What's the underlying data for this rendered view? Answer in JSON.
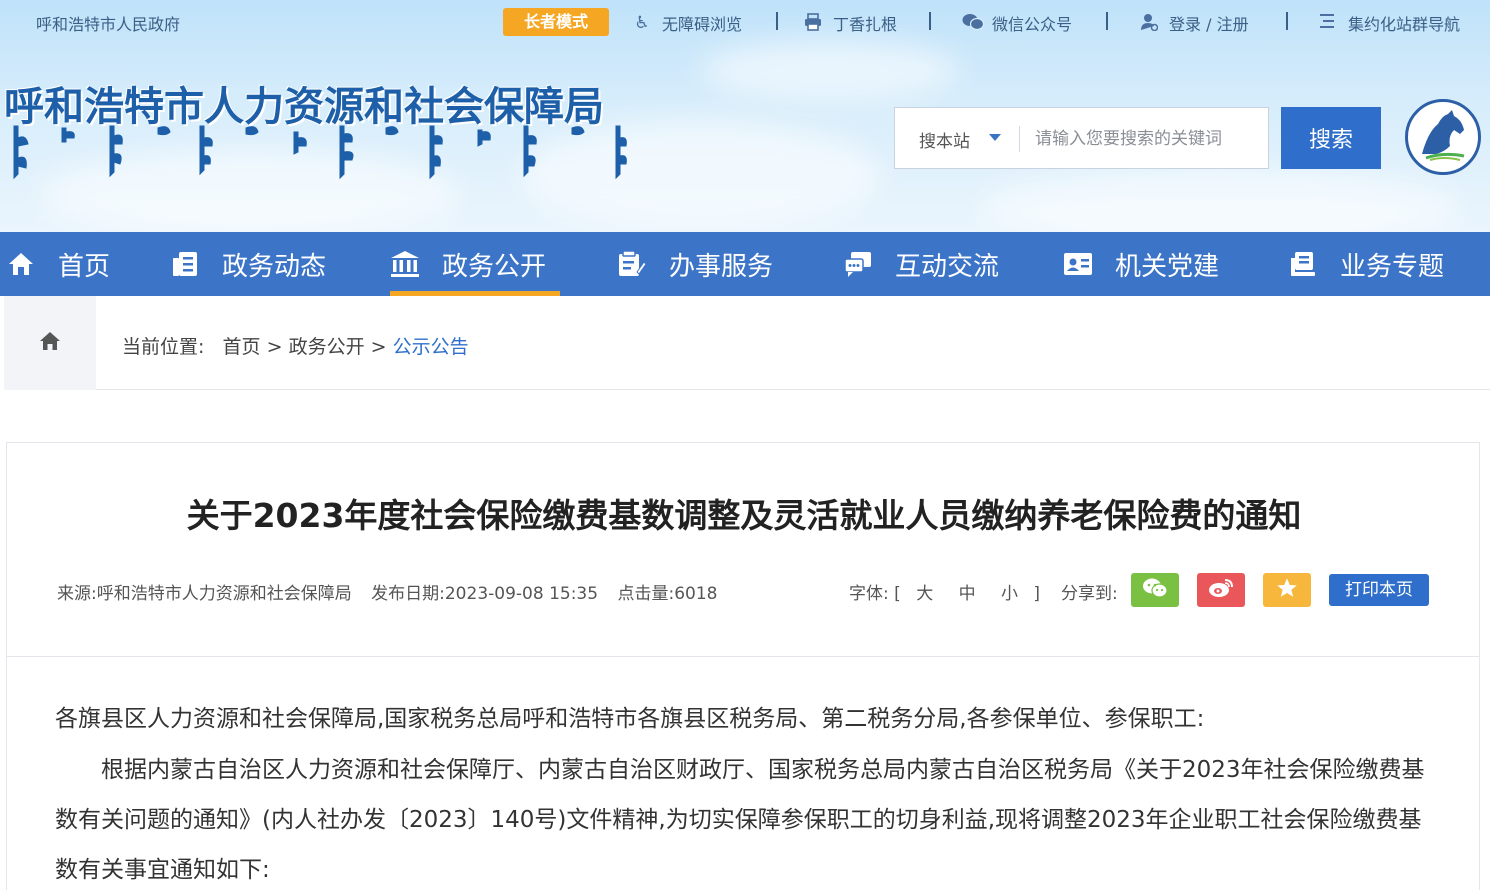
{
  "topbar": {
    "gov_link": "呼和浩特市人民政府",
    "elder_mode": "长者模式",
    "accessibility": "无障碍浏览",
    "dingxiang": "丁香扎根",
    "wechat": "微信公众号",
    "login": "登录 / 注册",
    "site_group": "集约化站群导航"
  },
  "header": {
    "site_title": "呼和浩特市人力资源和社会保障局"
  },
  "search": {
    "scope": "搜本站",
    "placeholder": "请输入您要搜索的关键词",
    "button": "搜索"
  },
  "nav": {
    "items": [
      {
        "label": "首页",
        "icon": "home-icon"
      },
      {
        "label": "政务动态",
        "icon": "news-icon"
      },
      {
        "label": "政务公开",
        "icon": "building-icon"
      },
      {
        "label": "办事服务",
        "icon": "service-icon"
      },
      {
        "label": "互动交流",
        "icon": "chat-icon"
      },
      {
        "label": "机关党建",
        "icon": "id-card-icon"
      },
      {
        "label": "业务专题",
        "icon": "topic-icon"
      }
    ],
    "active_index": 2
  },
  "breadcrumb": {
    "prefix": "当前位置:",
    "items": [
      "首页",
      "政务公开",
      "公示公告"
    ],
    "separator": ">"
  },
  "article": {
    "title": "关于2023年度社会保险缴费基数调整及灵活就业人员缴纳养老保险费的通知",
    "source": "来源:呼和浩特市人力资源和社会保障局",
    "date": "发布日期:2023-09-08 15:35",
    "clicks": "点击量:6018",
    "font_label": "字体:",
    "font_open": "[",
    "font_close": "]",
    "font_sizes": [
      "大",
      "中",
      "小"
    ],
    "share_label": "分享到:",
    "print": "打印本页",
    "paragraph_1": "各旗县区人力资源和社会保障局,国家税务总局呼和浩特市各旗县区税务局、第二税务分局,各参保单位、参保职工:",
    "paragraph_2": "根据内蒙古自治区人力资源和社会保障厅、内蒙古自治区财政厅、国家税务总局内蒙古自治区税务局《关于2023年社会保险缴费基数有关问题的通知》(内人社办发〔2023〕140号)文件精神,为切实保障参保职工的切身利益,现将调整2023年企业职工社会保险缴费基数有关事宜通知如下:"
  },
  "colors": {
    "nav_blue": "#3c74c8",
    "accent_orange": "#f5a623",
    "link_blue": "#2f6fcb",
    "wechat_green": "#7ac143",
    "weibo_red": "#e9575b",
    "favorite_yellow": "#f6b73c"
  }
}
